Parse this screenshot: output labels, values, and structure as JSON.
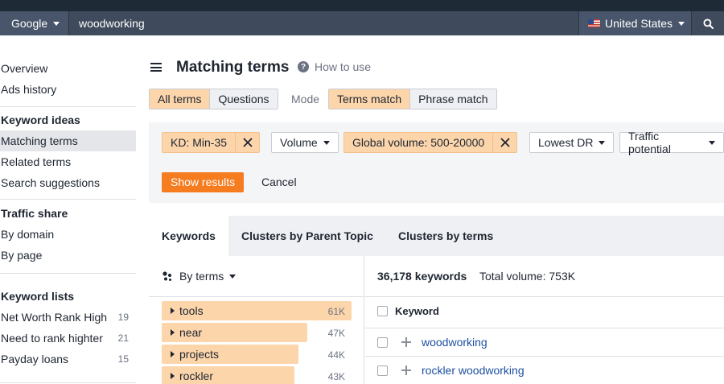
{
  "search": {
    "engine": "Google",
    "query": "woodworking",
    "country": "United States"
  },
  "sidebar": {
    "top_items": [
      "Overview",
      "Ads history"
    ],
    "sections": [
      {
        "heading": "Keyword ideas",
        "items": [
          "Matching terms",
          "Related terms",
          "Search suggestions"
        ]
      },
      {
        "heading": "Traffic share",
        "items": [
          "By domain",
          "By page"
        ]
      },
      {
        "heading": "Keyword lists",
        "items": [
          {
            "label": "Net Worth Rank High",
            "count": "19"
          },
          {
            "label": "Need to rank highter",
            "count": "21"
          },
          {
            "label": "Payday loans",
            "count": "15"
          }
        ]
      }
    ],
    "active_item": "Matching terms"
  },
  "header": {
    "title": "Matching terms",
    "help_link": "How to use"
  },
  "term_filter": {
    "options": [
      "All terms",
      "Questions"
    ],
    "selected": "All terms"
  },
  "mode": {
    "label": "Mode",
    "options": [
      "Terms match",
      "Phrase match"
    ],
    "selected": "Terms match"
  },
  "filters": {
    "kd": "KD: Min-35",
    "volume": "Volume",
    "global_volume": "Global volume: 500-20000",
    "lowest_dr": "Lowest DR",
    "traffic_potential": "Traffic potential",
    "show_results": "Show results",
    "cancel": "Cancel"
  },
  "tabs": [
    "Keywords",
    "Clusters by Parent Topic",
    "Clusters by terms"
  ],
  "active_tab": "Keywords",
  "terms_panel": {
    "group_by": "By terms",
    "terms": [
      {
        "label": "tools",
        "count": "61K",
        "fraction": 1.0
      },
      {
        "label": "near",
        "count": "47K",
        "fraction": 0.766
      },
      {
        "label": "projects",
        "count": "44K",
        "fraction": 0.72
      },
      {
        "label": "rockler",
        "count": "43K",
        "fraction": 0.7
      }
    ]
  },
  "results": {
    "keyword_count": "36,178 keywords",
    "total_volume": "Total volume: 753K",
    "column_keyword": "Keyword",
    "rows": [
      "woodworking",
      "rockler woodworking"
    ]
  },
  "colors": {
    "accent_orange": "#f57c1f",
    "selected_fill": "#fcd5ab",
    "link": "#1d4fa0",
    "topbar": "#3f4b5c"
  }
}
